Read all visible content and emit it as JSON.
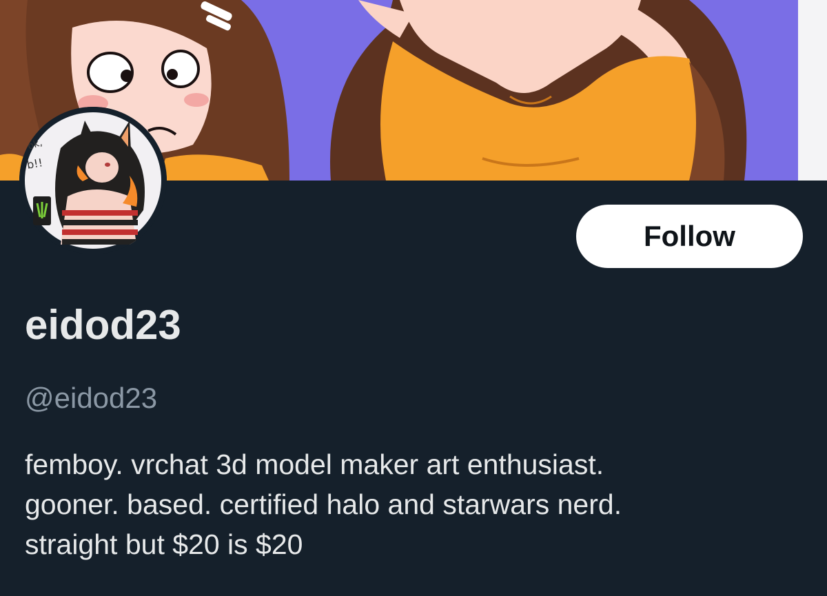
{
  "profile": {
    "display_name": "eidod23",
    "handle": "@eidod23",
    "follow_label": "Follow",
    "bio_lines": [
      "femboy. vrchat 3d model maker art enthusiast.",
      "gooner. based. certified halo and starwars nerd.",
      "straight but $20 is $20"
    ]
  },
  "avatar": {
    "sticker_text": "ok, b!!"
  },
  "colors": {
    "background": "#15202b",
    "primary_text": "#e7e9ea",
    "secondary_text": "#8b98a5",
    "follow_bg": "#ffffff",
    "follow_text": "#0f1419",
    "banner_purple": "#7a6ee6",
    "banner_orange": "#f5a02a"
  }
}
